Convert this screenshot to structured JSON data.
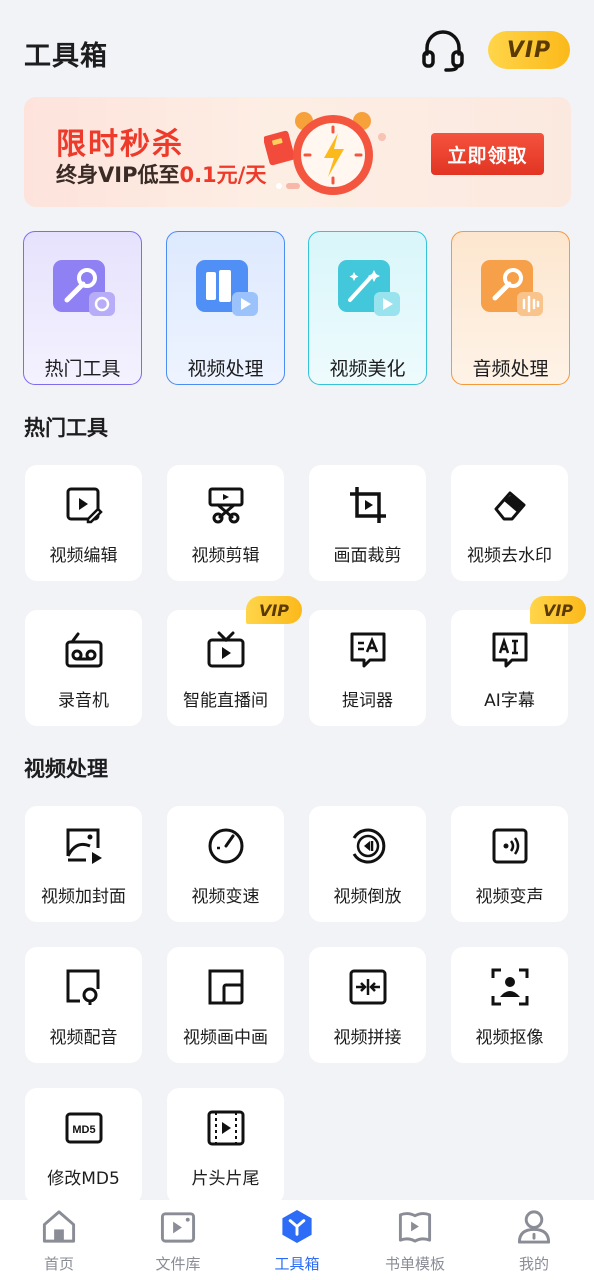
{
  "header": {
    "title": "工具箱",
    "vip": "VIP"
  },
  "banner": {
    "title": "限时秒杀",
    "subtitle_prefix": "终身VIP低至",
    "subtitle_highlight": "0.1元/天",
    "button": "立即领取"
  },
  "categories": [
    {
      "label": "热门工具",
      "icon": "wrench-icon",
      "color": "#7d6cf0"
    },
    {
      "label": "视频处理",
      "icon": "video-grid-icon",
      "color": "#4b8cf5"
    },
    {
      "label": "视频美化",
      "icon": "magic-wand-icon",
      "color": "#34c3d8"
    },
    {
      "label": "音频处理",
      "icon": "audio-wrench-icon",
      "color": "#f39a3c"
    }
  ],
  "sections": {
    "hot_tools": {
      "title": "热门工具",
      "items": [
        {
          "label": "视频编辑",
          "icon": "video-edit-icon"
        },
        {
          "label": "视频剪辑",
          "icon": "scissors-icon"
        },
        {
          "label": "画面裁剪",
          "icon": "crop-icon"
        },
        {
          "label": "视频去水印",
          "icon": "eraser-icon"
        },
        {
          "label": "录音机",
          "icon": "recorder-icon"
        },
        {
          "label": "智能直播间",
          "icon": "tv-icon",
          "badge": "VIP"
        },
        {
          "label": "提词器",
          "icon": "teleprompter-icon"
        },
        {
          "label": "AI字幕",
          "icon": "ai-subtitle-icon",
          "badge": "VIP"
        }
      ]
    },
    "video_processing": {
      "title": "视频处理",
      "items": [
        {
          "label": "视频加封面",
          "icon": "cover-icon"
        },
        {
          "label": "视频变速",
          "icon": "speedometer-icon"
        },
        {
          "label": "视频倒放",
          "icon": "rewind-icon"
        },
        {
          "label": "视频变声",
          "icon": "voice-change-icon"
        },
        {
          "label": "视频配音",
          "icon": "dubbing-icon"
        },
        {
          "label": "视频画中画",
          "icon": "pip-icon"
        },
        {
          "label": "视频拼接",
          "icon": "merge-icon"
        },
        {
          "label": "视频抠像",
          "icon": "portrait-cutout-icon"
        },
        {
          "label": "修改MD5",
          "icon": "md5-icon",
          "icon_text": "MD5"
        },
        {
          "label": "片头片尾",
          "icon": "film-icon"
        }
      ]
    }
  },
  "bottom_nav": [
    {
      "label": "首页",
      "icon": "home-icon",
      "active": false
    },
    {
      "label": "文件库",
      "icon": "file-library-icon",
      "active": false
    },
    {
      "label": "工具箱",
      "icon": "toolbox-icon",
      "active": true
    },
    {
      "label": "书单模板",
      "icon": "book-template-icon",
      "active": false
    },
    {
      "label": "我的",
      "icon": "profile-icon",
      "active": false
    }
  ],
  "colors": {
    "accent": "#2c6cf6",
    "banner_red": "#ee3a2a",
    "vip_gold": "#fbb91a",
    "background": "#f2f3f7"
  }
}
